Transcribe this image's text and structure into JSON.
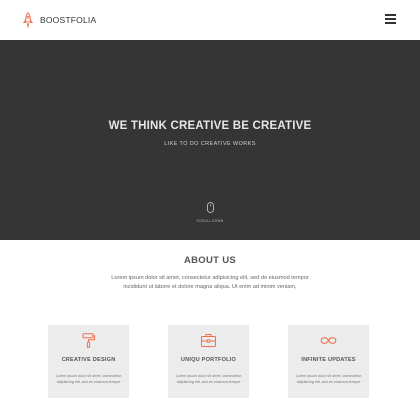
{
  "navbar": {
    "brand_name": "BOOSTFOLIA",
    "logo_icon": "rocket-icon",
    "menu_icon": "hamburger-menu-icon"
  },
  "hero": {
    "title": "WE THINK CREATIVE BE CREATIVE",
    "subtitle": "LIKE TO DO CREATIVE WORKS",
    "scroll_icon": "mouse-icon",
    "scroll_label": "SCROLL DOWN"
  },
  "about": {
    "title": "ABOUT US",
    "text": "Lorem ipsum dolor sit amet, consectetur adipisicing elit, sed do eiusmod tempor incididunt ut labore et dolore magna aliqua. Ut enim ad minim veniam,"
  },
  "features": [
    {
      "title": "CREATIVE DESIGN",
      "icon": "paint-roller-icon",
      "text": "Lorem ipsum dolor sit amet, consectetur adipisicing elit, sed do eiusmod tempor"
    },
    {
      "title": "UNIQU PORTFOLIO",
      "icon": "briefcase-icon",
      "text": "Lorem ipsum dolor sit amet, consectetur adipisicing elit, sed do eiusmod tempor"
    },
    {
      "title": "INFINITE UPDATES",
      "icon": "infinity-icon",
      "text": "Lorem ipsum dolor sit amet, consectetur adipisicing elit, sed do eiusmod tempor"
    }
  ],
  "colors": {
    "accent": "#f0714f",
    "hero_background": "#353535",
    "card_background": "#ececec"
  }
}
